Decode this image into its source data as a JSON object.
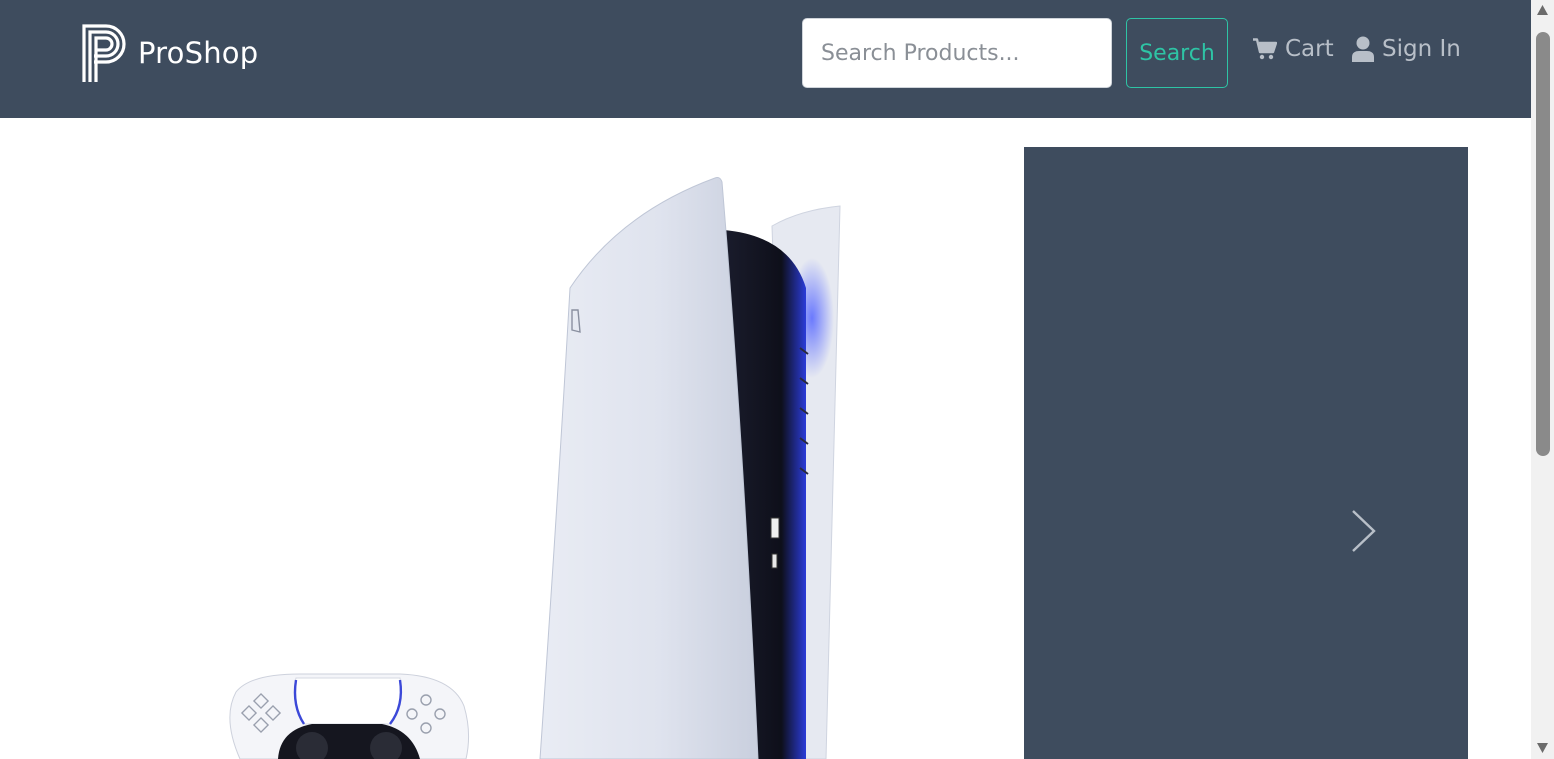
{
  "navbar": {
    "brand_name": "ProShop",
    "search_placeholder": "Search Products...",
    "search_button_label": "Search",
    "cart_label": "Cart",
    "signin_label": "Sign In"
  },
  "product": {
    "image_icon": "game-console-controller-image"
  },
  "carousel": {
    "next_icon": "chevron-right-icon"
  },
  "colors": {
    "navbar_bg": "#3e4c5e",
    "accent": "#2ec4a5",
    "nav_link": "#b8bfc8",
    "panel_bg": "#3e4c5e"
  }
}
